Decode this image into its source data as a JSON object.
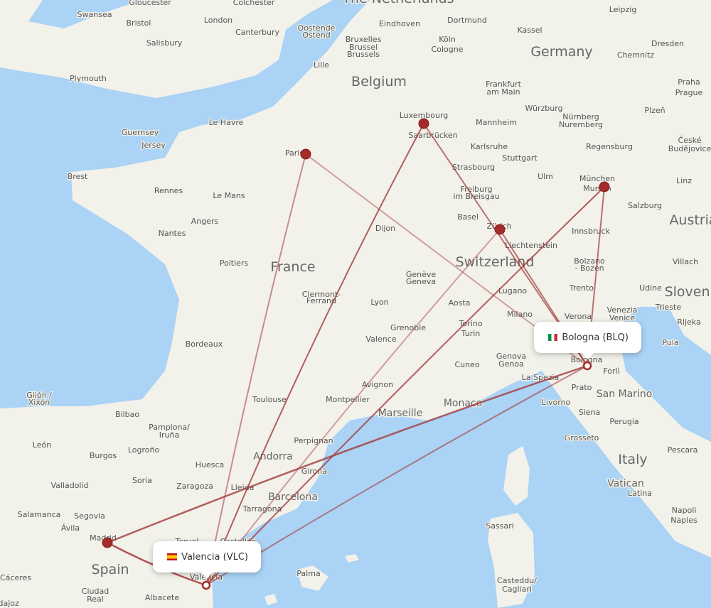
{
  "map": {
    "colors": {
      "water": "#aad3f5",
      "land": "#f2f1ea",
      "route": "#a33a3a",
      "hub": "#a52a2a"
    },
    "origin": {
      "name": "Valencia (VLC)",
      "flag": "spain-flag"
    },
    "destination": {
      "name": "Bologna (BLQ)",
      "flag": "italy-flag"
    },
    "hubs": [
      "Madrid",
      "Paris",
      "Luxembourg",
      "Zürich",
      "München"
    ],
    "countries": [
      "The Netherlands",
      "Belgium",
      "Germany",
      "France",
      "Switzerland",
      "Austria",
      "Slovenia",
      "Italy",
      "Spain"
    ],
    "mid_labels": [
      "Marseille",
      "Monaco",
      "Andorra",
      "Barcelona",
      "San Marino",
      "Vatican"
    ],
    "cities": [
      "Swansea",
      "Gloucester",
      "Bristol",
      "London",
      "Colchester",
      "Canterbury",
      "Salisbury",
      "Plymouth",
      "Oostende",
      "Ostend",
      "Bruxelles",
      "Brussel",
      "Brussels",
      "Eindhoven",
      "Dortmund",
      "Kassel",
      "Leipzig",
      "Köln",
      "Cologne",
      "Lille",
      "Dresden",
      "Chemnitz",
      "Praha",
      "Prague",
      "Frankfurt",
      "am Main",
      "Luxembourg",
      "Saarbrücken",
      "Mannheim",
      "Würzburg",
      "Nürnberg",
      "Nuremberg",
      "Plzeň",
      "České",
      "Budějovice",
      "Karlsruhe",
      "Stuttgart",
      "Regensburg",
      "Strasbourg",
      "Ulm",
      "München",
      "Munich",
      "Linz",
      "Freiburg",
      "im Breisgau",
      "Basel",
      "Salzburg",
      "Zürich",
      "Innsbruck",
      "Liechtenstein",
      "Bolzano",
      "- Bozen",
      "Villach",
      "Lugano",
      "Trento",
      "Udine",
      "Milano",
      "Verona",
      "Venezia",
      "Venice",
      "Trieste",
      "Rijeka",
      "Torino",
      "Turin",
      "Aosta",
      "Genova",
      "Genoa",
      "Cuneo",
      "Bologna",
      "Forlì",
      "Pula",
      "La Spezia",
      "Prato",
      "Livorno",
      "Siena",
      "Perugia",
      "Grosseto",
      "Pescara",
      "Latina",
      "Napoli",
      "Naples",
      "Sassari",
      "Casteddu/",
      "Cagliari",
      "Guernsey",
      "Jersey",
      "Brest",
      "Rennes",
      "Le Havre",
      "Paris",
      "Le Mans",
      "Angers",
      "Nantes",
      "Poitiers",
      "Dijon",
      "Genève",
      "Geneva",
      "Clermont-",
      "Ferrand",
      "Lyon",
      "Grenoble",
      "Valence",
      "Bordeaux",
      "Avignon",
      "Montpellier",
      "Toulouse",
      "Perpignan",
      "Girona",
      "Tarragona",
      "Lleida",
      "Huesca",
      "Zaragoza",
      "Pamplona/",
      "Iruña",
      "Bilbao",
      "Gijón /",
      "Xixón",
      "León",
      "Burgos",
      "Logroño",
      "Soria",
      "Valladolid",
      "Salamanca",
      "Segovia",
      "Ávila",
      "Madrid",
      "Teruel",
      "Castellón",
      "Valencia",
      "Cáceres",
      "Ciudad",
      "Real",
      "Albacete",
      "Badajoz",
      "Palma"
    ]
  }
}
